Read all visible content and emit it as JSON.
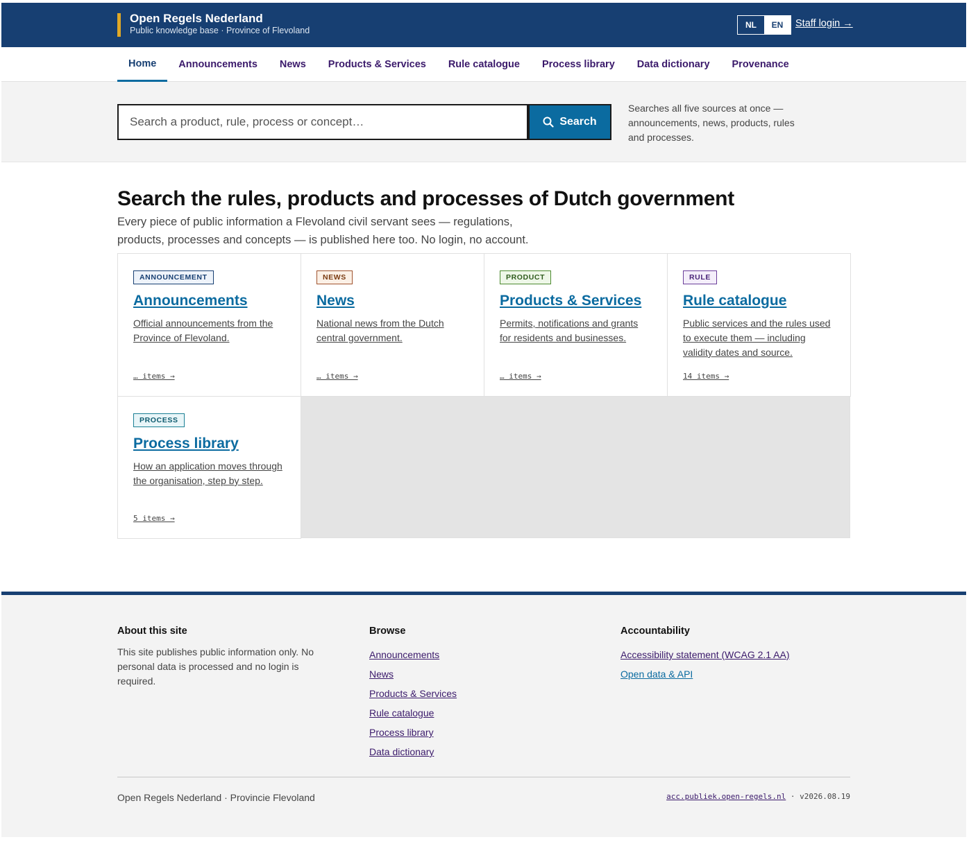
{
  "header": {
    "title": "Open Regels Nederland",
    "subtitle": "Public knowledge base · Province of Flevoland",
    "lang_nl": "NL",
    "lang_en": "EN",
    "staff_login": "Staff login →"
  },
  "colors": {
    "brand": "#173f72",
    "accent": "#e0a826",
    "link": "#0b6ba0",
    "nav_text": "#3b1a6b"
  },
  "nav": {
    "items": [
      {
        "label": "Home",
        "active": true
      },
      {
        "label": "Announcements"
      },
      {
        "label": "News"
      },
      {
        "label": "Products & Services"
      },
      {
        "label": "Rule catalogue"
      },
      {
        "label": "Process library"
      },
      {
        "label": "Data dictionary"
      },
      {
        "label": "Provenance"
      }
    ]
  },
  "search": {
    "placeholder": "Search a product, rule, process or concept…",
    "button": "Search",
    "help": "Searches all five sources at once — announcements, news, products, rules and processes."
  },
  "hero": {
    "title": "Search the rules, products and processes of Dutch government",
    "subtitle": "Every piece of public information a Flevoland civil servant sees — regulations, products, processes and concepts — is published here too. No login, no account."
  },
  "cards": [
    {
      "badge": "ANNOUNCEMENT",
      "title": "Announcements",
      "desc": "Official announcements from the Province of Flevoland.",
      "count": "… items →"
    },
    {
      "badge": "NEWS",
      "title": "News",
      "desc": "National news from the Dutch central government.",
      "count": "… items →"
    },
    {
      "badge": "PRODUCT",
      "title": "Products & Services",
      "desc": "Permits, notifications and grants for residents and businesses.",
      "count": "… items →"
    },
    {
      "badge": "RULE",
      "title": "Rule catalogue",
      "desc": "Public services and the rules used to execute them — including validity dates and source.",
      "count": "14 items →"
    },
    {
      "badge": "PROCESS",
      "title": "Process library",
      "desc": "How an application moves through the organisation, step by step.",
      "count": "5 items →"
    }
  ],
  "footer": {
    "about_head": "About this site",
    "about_text": "This site publishes public information only. No personal data is processed and no login is required.",
    "browse_head": "Browse",
    "browse_links": [
      "Announcements",
      "News",
      "Products & Services",
      "Rule catalogue",
      "Process library",
      "Data dictionary"
    ],
    "acc_head": "Accountability",
    "acc_links": [
      "Accessibility statement (WCAG 2.1 AA)",
      "Open data & API"
    ],
    "copy": "Open Regels Nederland · Provincie Flevoland",
    "host": "acc.publiek.open-regels.nl",
    "version": " · v2026.08.19"
  }
}
